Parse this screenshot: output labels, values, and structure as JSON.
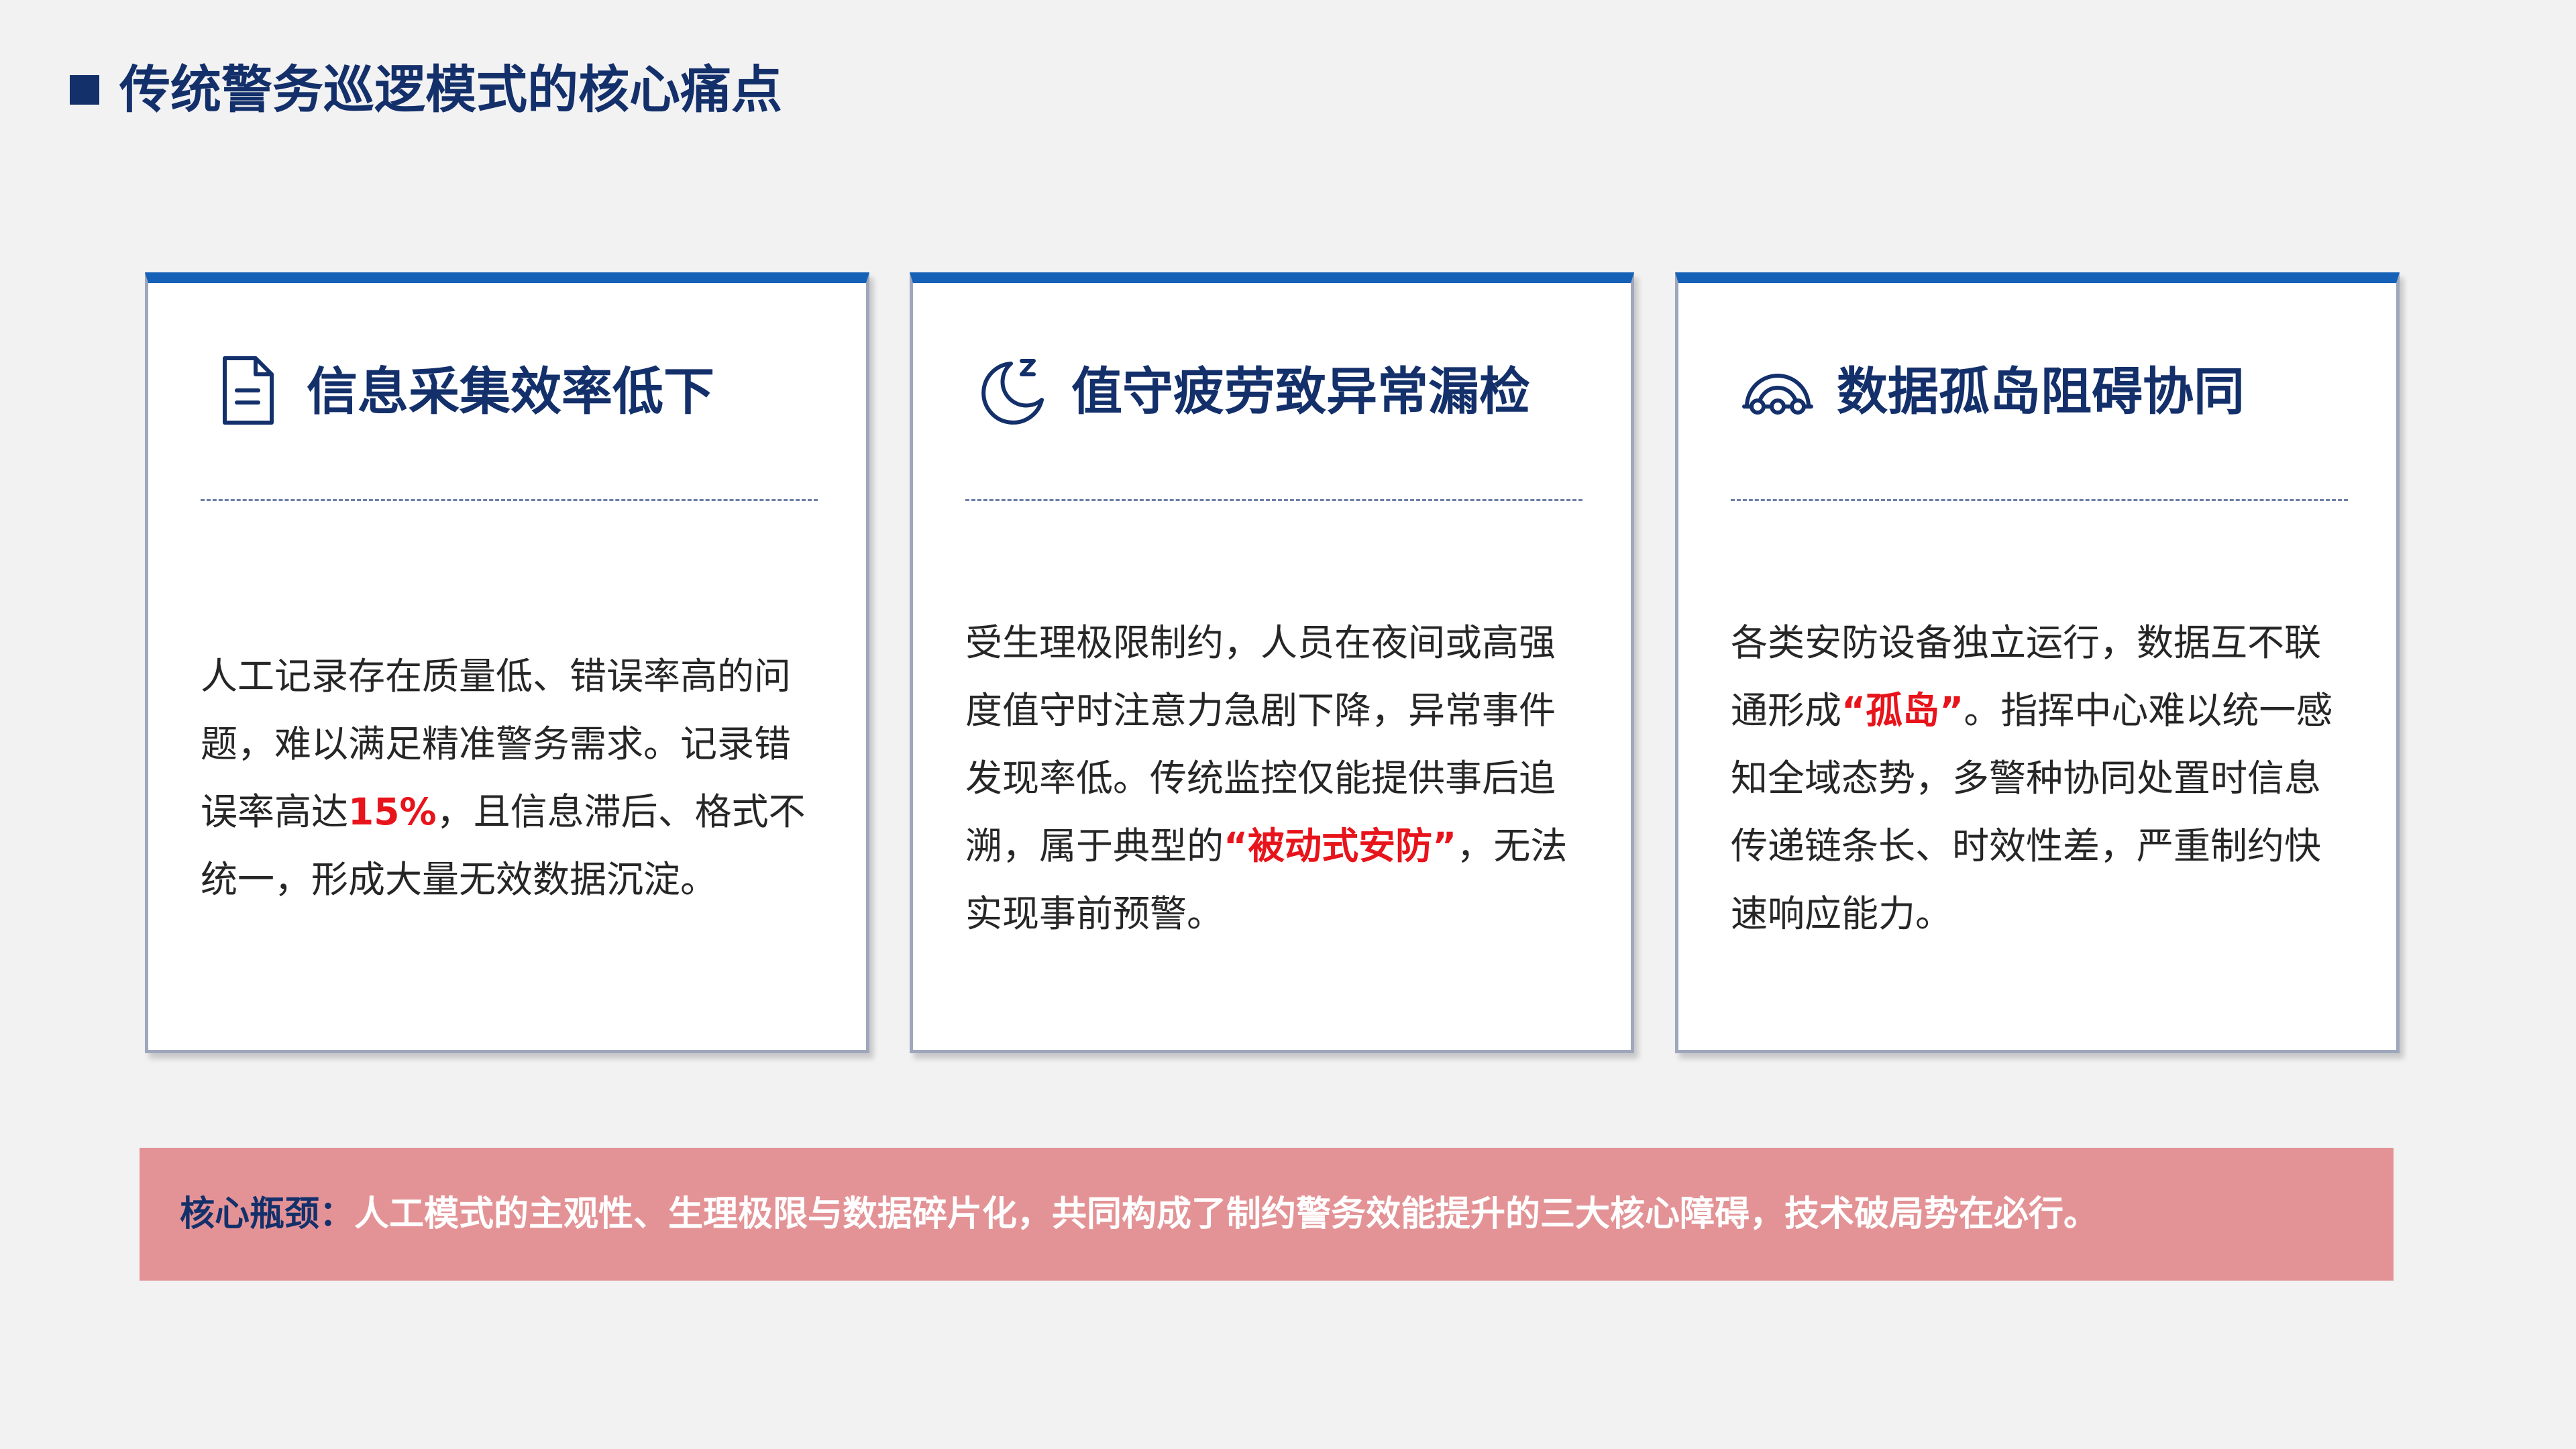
{
  "header": {
    "title": "传统警务巡逻模式的核心痛点"
  },
  "cards": [
    {
      "icon": "document-icon",
      "title": "信息采集效率低下",
      "body": {
        "before": "人工记录存在质量低、错误率高的问题，难以满足精准警务需求。记录错误率高达",
        "highlight": "15%",
        "after": "，且信息滞后、格式不统一，形成大量无效数据沉淀。"
      }
    },
    {
      "icon": "moon-sleep-icon",
      "title": "值守疲劳致异常漏检",
      "body": {
        "before": "受生理极限制约，人员在夜间或高强度值守时注意力急剧下降，异常事件发现率低。传统监控仅能提供事后追溯，属于典型的",
        "highlight": "“被动式安防”",
        "after": "，无法实现事前预警。"
      }
    },
    {
      "icon": "network-arch-icon",
      "title": "数据孤岛阻碍协同",
      "body": {
        "before": "各类安防设备独立运行，数据互不联通形成",
        "highlight": "“孤岛”",
        "after": "。指挥中心难以统一感知全域态势，多警种协同处置时信息传递链条长、时效性差，严重制约快速响应能力。"
      }
    }
  ],
  "banner": {
    "label": "核心瓶颈：",
    "text": "人工模式的主观性、生理极限与数据碎片化，共同构成了制约警务效能提升的三大核心障碍，技术破局势在必行。"
  },
  "colors": {
    "navy": "#14306B",
    "accent_blue": "#1661B8",
    "highlight_red": "#E8141B",
    "banner_pink": "#E39396",
    "page_bg": "#F2F2F3"
  }
}
